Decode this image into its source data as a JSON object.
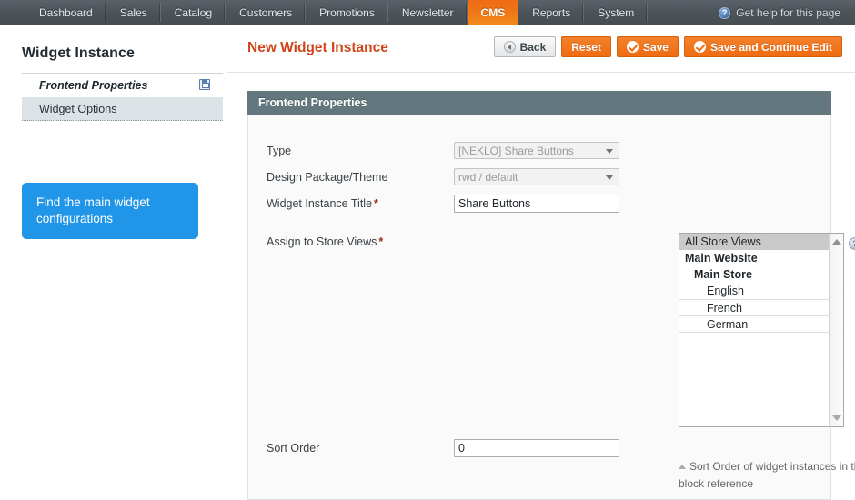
{
  "topnav": {
    "items": [
      {
        "label": "Dashboard",
        "active": false
      },
      {
        "label": "Sales",
        "active": false
      },
      {
        "label": "Catalog",
        "active": false
      },
      {
        "label": "Customers",
        "active": false
      },
      {
        "label": "Promotions",
        "active": false
      },
      {
        "label": "Newsletter",
        "active": false
      },
      {
        "label": "CMS",
        "active": true
      },
      {
        "label": "Reports",
        "active": false
      },
      {
        "label": "System",
        "active": false
      }
    ],
    "help_label": "Get help for this page",
    "help_icon": "question-circle-icon",
    "active_color": "#ef7415"
  },
  "sidebar": {
    "title": "Widget Instance",
    "tabs": [
      {
        "label": "Frontend Properties",
        "state": "current",
        "icon": "floppy-disk-save-icon"
      },
      {
        "label": "Widget Options",
        "state": "selected",
        "icon": ""
      }
    ],
    "callout": {
      "text": "Find the main widget configurations",
      "color": "#2196e8"
    }
  },
  "content": {
    "page_title": "New Widget Instance",
    "title_color": "#d0451b",
    "buttons": [
      {
        "label": "Back",
        "style": "gray",
        "icon": "circle-left-arrow-icon"
      },
      {
        "label": "Reset",
        "style": "orange",
        "icon": ""
      },
      {
        "label": "Save",
        "style": "orange",
        "icon": "check-circle-icon"
      },
      {
        "label": "Save and Continue Edit",
        "style": "orange",
        "icon": "check-circle-icon"
      }
    ],
    "panel": {
      "header": "Frontend Properties",
      "header_color": "#63787e",
      "fields": {
        "type": {
          "label": "Type",
          "value": "[NEKLO] Share Buttons",
          "disabled": true
        },
        "design": {
          "label": "Design Package/Theme",
          "value": "rwd / default",
          "disabled": true
        },
        "title": {
          "label": "Widget Instance Title",
          "required": "*",
          "value": "Share Buttons"
        },
        "store_views": {
          "label": "Assign to Store Views",
          "required": "*",
          "help_icon": "question-circle-icon",
          "options": [
            {
              "text": "All Store Views",
              "indent": 0,
              "group": false,
              "selected": true,
              "separator": false
            },
            {
              "text": "Main Website",
              "indent": 0,
              "group": true,
              "selected": false,
              "separator": false
            },
            {
              "text": "Main Store",
              "indent": 1,
              "group": true,
              "selected": false,
              "separator": false
            },
            {
              "text": "English",
              "indent": 2,
              "group": false,
              "selected": false,
              "separator": false
            },
            {
              "text": "French",
              "indent": 2,
              "group": false,
              "selected": false,
              "separator": true
            },
            {
              "text": "German",
              "indent": 2,
              "group": false,
              "selected": false,
              "separator": true
            }
          ],
          "scroll_up_icon": "scroll-up-arrow-icon",
          "scroll_down_icon": "scroll-down-arrow-icon"
        },
        "sort_order": {
          "label": "Sort Order",
          "value": "0",
          "hint": "Sort Order of widget instances in the same block reference"
        }
      }
    }
  }
}
